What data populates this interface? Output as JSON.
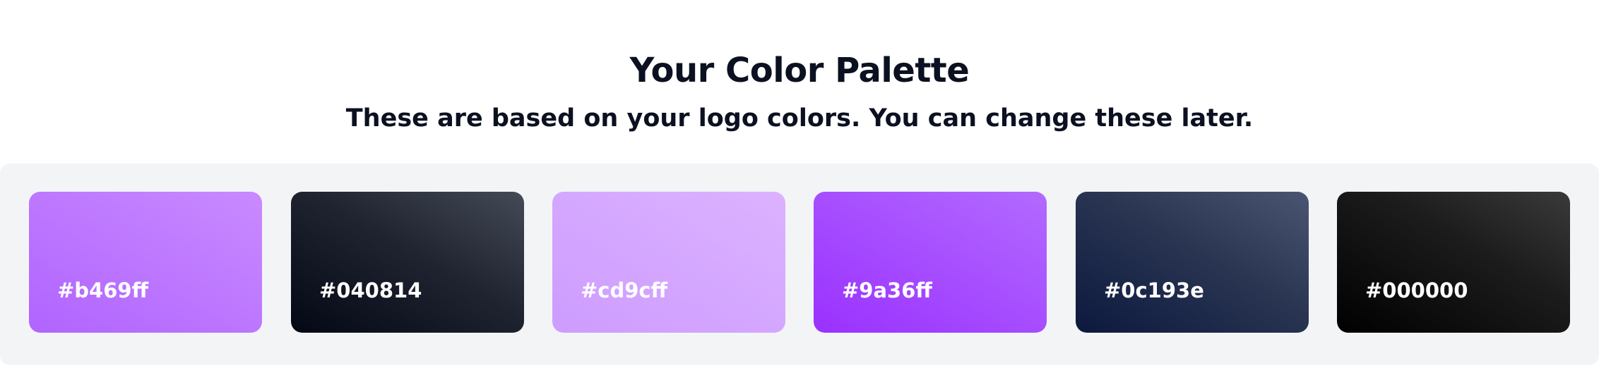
{
  "header": {
    "title": "Your Color Palette",
    "subtitle": "These are based on your logo colors. You can change these later."
  },
  "palette": {
    "swatches": [
      {
        "label": "#b469ff",
        "color": "#b469ff"
      },
      {
        "label": "#040814",
        "color": "#040814"
      },
      {
        "label": "#cd9cff",
        "color": "#cd9cff"
      },
      {
        "label": "#9a36ff",
        "color": "#9a36ff"
      },
      {
        "label": "#0c193e",
        "color": "#0c193e"
      },
      {
        "label": "#000000",
        "color": "#000000"
      }
    ]
  }
}
